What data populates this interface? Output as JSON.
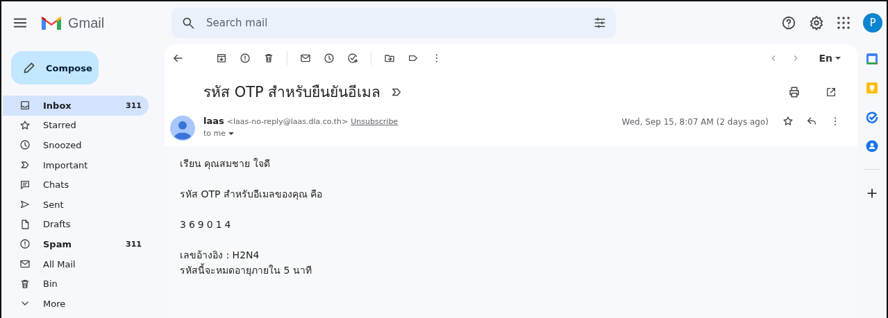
{
  "header": {
    "app_name": "Gmail",
    "search": {
      "placeholder": "Search mail"
    },
    "avatar_letter": "P"
  },
  "compose": "Compose",
  "nav": [
    {
      "label": "Inbox",
      "count": "311",
      "selected": true,
      "unread": true
    },
    {
      "label": "Starred",
      "selected": false,
      "unread": false
    },
    {
      "label": "Snoozed",
      "selected": false,
      "unread": false
    },
    {
      "label": "Important",
      "selected": false,
      "unread": false
    },
    {
      "label": "Chats",
      "selected": false,
      "unread": false
    },
    {
      "label": "Sent",
      "selected": false,
      "unread": false
    },
    {
      "label": "Drafts",
      "selected": false,
      "unread": false
    },
    {
      "label": "Spam",
      "count": "311",
      "selected": false,
      "unread": true
    },
    {
      "label": "All Mail",
      "selected": false,
      "unread": false
    },
    {
      "label": "Bin",
      "selected": false,
      "unread": false
    },
    {
      "label": "More",
      "selected": false,
      "unread": false
    }
  ],
  "toolbar": {
    "language": "En"
  },
  "message": {
    "subject": "รหัส OTP สำหรับยืนยันอีเมล",
    "sender_name": "laas",
    "sender_email": "<laas-no-reply@laas.dla.co.th>",
    "unsubscribe": "Unsubscribe",
    "recipient": "to me",
    "date": "Wed, Sep 15, 8:07 AM (2 days ago)",
    "body": [
      {
        "kind": "text",
        "lines": [
          "เรียน คุณสมชาย ใจดี"
        ]
      },
      {
        "kind": "text",
        "lines": [
          "รหัส OTP สำหรับอีเมลของคุณ คือ"
        ]
      },
      {
        "kind": "code",
        "lines": [
          "369014"
        ]
      },
      {
        "kind": "text",
        "lines": [
          "เลขอ้างอิง : H2N4",
          "รหัสนี้จะหมดอายุภายใน 5 นาที"
        ]
      }
    ]
  }
}
